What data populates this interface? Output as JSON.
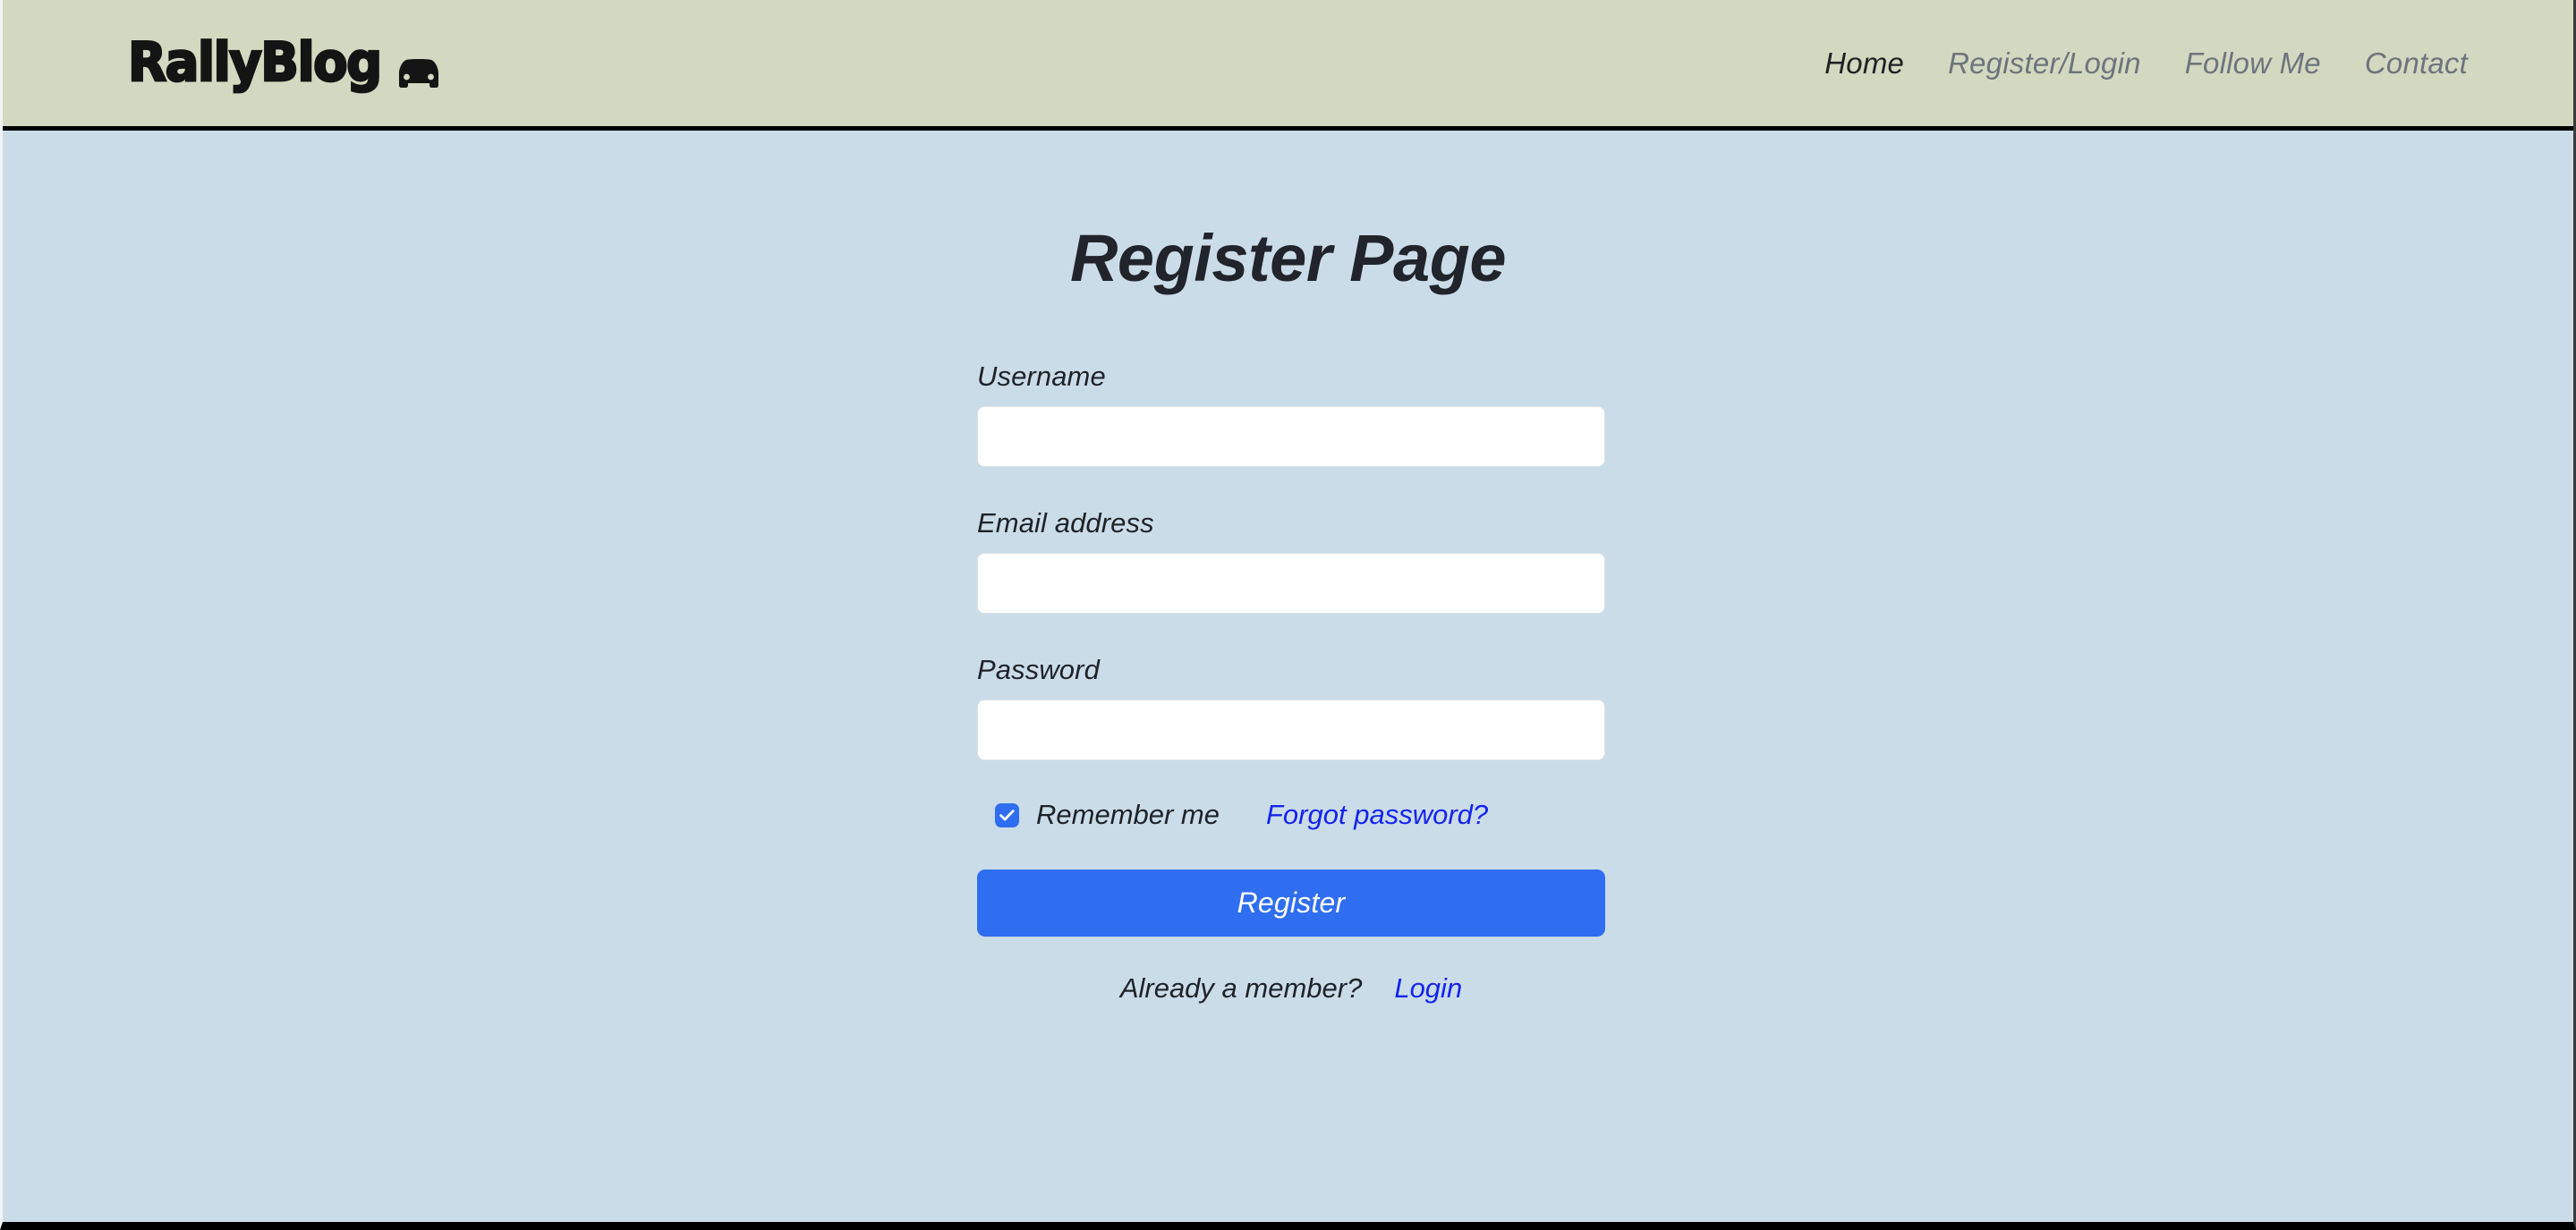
{
  "theme": {
    "header_bg": "#d3d8c0",
    "body_bg": "#cbdce9",
    "accent_blue": "#2f6ef0",
    "link_blue": "#1424f0",
    "text_dark": "#1e2227",
    "nav_muted": "#6c757d",
    "input_bg": "#ffffff",
    "rule_color": "#000000"
  },
  "header": {
    "brand_text": "RallyBlog",
    "brand_icon": "car-icon",
    "nav": [
      {
        "label": "Home",
        "active": true
      },
      {
        "label": "Register/Login",
        "active": false
      },
      {
        "label": "Follow Me",
        "active": false
      },
      {
        "label": "Contact",
        "active": false
      }
    ]
  },
  "main": {
    "title": "Register Page",
    "form": {
      "username": {
        "label": "Username",
        "value": "",
        "placeholder": ""
      },
      "email": {
        "label": "Email address",
        "value": "",
        "placeholder": ""
      },
      "password": {
        "label": "Password",
        "value": "",
        "placeholder": ""
      },
      "remember": {
        "label": "Remember me",
        "checked": true
      },
      "forgot_link": "Forgot password?",
      "submit_label": "Register",
      "footer_text": "Already a member?",
      "footer_link": "Login"
    }
  }
}
